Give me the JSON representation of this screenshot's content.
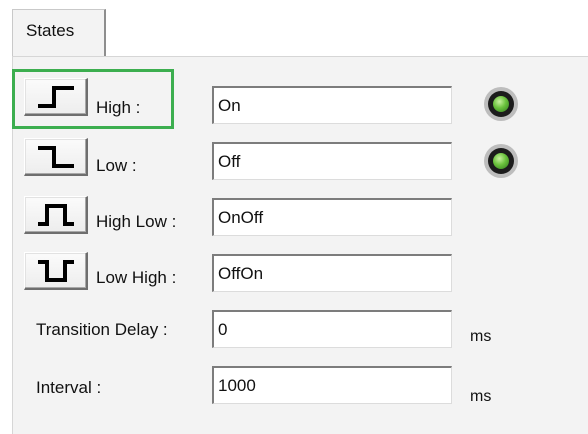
{
  "tabs": [
    {
      "label": "States"
    }
  ],
  "states": [
    {
      "label": "High :",
      "value": "On",
      "icon": "rising-edge-icon",
      "led": true
    },
    {
      "label": "Low :",
      "value": "Off",
      "icon": "falling-edge-icon",
      "led": true
    },
    {
      "label": "High Low :",
      "value": "OnOff",
      "icon": "high-low-pulse-icon",
      "led": false
    },
    {
      "label": "Low High :",
      "value": "OffOn",
      "icon": "low-high-pulse-icon",
      "led": false
    }
  ],
  "transition_delay": {
    "label": "Transition Delay :",
    "value": "0",
    "unit": "ms"
  },
  "interval": {
    "label": "Interval :",
    "value": "1000",
    "unit": "ms"
  },
  "colors": {
    "highlight": "#3cae4f",
    "led": "#6bc23d"
  }
}
